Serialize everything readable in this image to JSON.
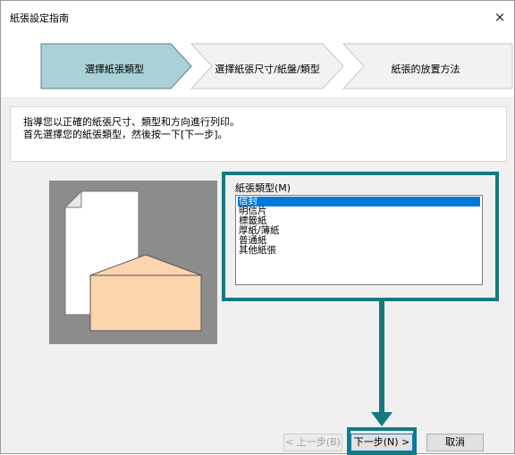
{
  "window": {
    "title": "紙張設定指南",
    "close_glyph": "×"
  },
  "steps": [
    {
      "label": "選擇紙張類型"
    },
    {
      "label": "選擇紙張尺寸/紙盤/類型"
    },
    {
      "label": "紙張的放置方法"
    }
  ],
  "instructions": {
    "line1": "指導您以正確的紙張尺寸、類型和方向進行列印。",
    "line2": "首先選擇您的紙張類型，然後按一下[下一步]。"
  },
  "paper_type": {
    "caption": "紙張類型(M)",
    "selected": "信封",
    "options": [
      "信封",
      "明信片",
      "標籤紙",
      "厚紙/薄紙",
      "普通紙",
      "其他紙張"
    ]
  },
  "buttons": {
    "back": "< 上一步(B)",
    "next": "下一步(N) >",
    "cancel": "取消"
  },
  "colors": {
    "accent": "#147a80",
    "active_step": "#a9d1d8",
    "envelope_fill": "#fcd5ac",
    "selection": "#0078d7"
  }
}
